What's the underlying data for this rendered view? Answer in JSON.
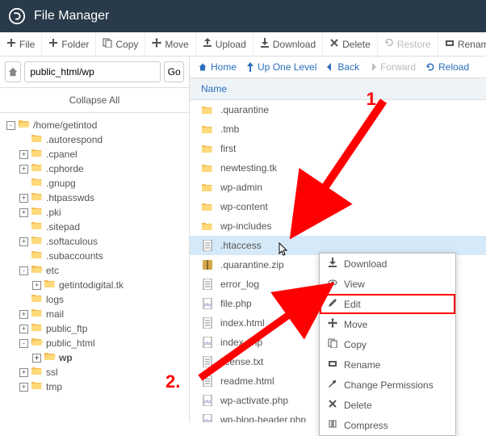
{
  "header": {
    "title": "File Manager"
  },
  "toolbar": [
    {
      "label": "File",
      "icon": "plus"
    },
    {
      "label": "Folder",
      "icon": "plus"
    },
    {
      "label": "Copy",
      "icon": "copy"
    },
    {
      "label": "Move",
      "icon": "move"
    },
    {
      "label": "Upload",
      "icon": "upload"
    },
    {
      "label": "Download",
      "icon": "download"
    },
    {
      "label": "Delete",
      "icon": "delete"
    },
    {
      "label": "Restore",
      "icon": "restore",
      "disabled": true
    },
    {
      "label": "Rename",
      "icon": "rename"
    }
  ],
  "path": {
    "value": "public_html/wp",
    "go": "Go"
  },
  "collapse": "Collapse All",
  "tree": [
    {
      "indent": 0,
      "toggle": "-",
      "type": "folder-open",
      "label": "/home/getintod"
    },
    {
      "indent": 1,
      "toggle": "",
      "type": "folder",
      "label": ".autorespond"
    },
    {
      "indent": 1,
      "toggle": "+",
      "type": "folder",
      "label": ".cpanel"
    },
    {
      "indent": 1,
      "toggle": "+",
      "type": "folder",
      "label": ".cphorde"
    },
    {
      "indent": 1,
      "toggle": "",
      "type": "folder",
      "label": ".gnupg"
    },
    {
      "indent": 1,
      "toggle": "+",
      "type": "folder",
      "label": ".htpasswds"
    },
    {
      "indent": 1,
      "toggle": "+",
      "type": "folder",
      "label": ".pki"
    },
    {
      "indent": 1,
      "toggle": "",
      "type": "folder",
      "label": ".sitepad"
    },
    {
      "indent": 1,
      "toggle": "+",
      "type": "folder",
      "label": ".softaculous"
    },
    {
      "indent": 1,
      "toggle": "",
      "type": "folder",
      "label": ".subaccounts"
    },
    {
      "indent": 1,
      "toggle": "-",
      "type": "folder-open",
      "label": "etc"
    },
    {
      "indent": 2,
      "toggle": "+",
      "type": "folder",
      "label": "getintodigital.tk"
    },
    {
      "indent": 1,
      "toggle": "",
      "type": "folder",
      "label": "logs"
    },
    {
      "indent": 1,
      "toggle": "+",
      "type": "folder",
      "label": "mail"
    },
    {
      "indent": 1,
      "toggle": "+",
      "type": "folder",
      "label": "public_ftp"
    },
    {
      "indent": 1,
      "toggle": "-",
      "type": "folder-open",
      "label": "public_html"
    },
    {
      "indent": 2,
      "toggle": "+",
      "type": "folder-open",
      "label": "wp",
      "bold": true
    },
    {
      "indent": 1,
      "toggle": "+",
      "type": "folder",
      "label": "ssl"
    },
    {
      "indent": 1,
      "toggle": "+",
      "type": "folder",
      "label": "tmp"
    }
  ],
  "nav": {
    "home": "Home",
    "up": "Up One Level",
    "back": "Back",
    "forward": "Forward",
    "reload": "Reload"
  },
  "col": {
    "name": "Name"
  },
  "files": [
    {
      "type": "folder",
      "label": ".quarantine"
    },
    {
      "type": "folder",
      "label": ".tmb"
    },
    {
      "type": "folder",
      "label": "first"
    },
    {
      "type": "folder",
      "label": "newtesting.tk"
    },
    {
      "type": "folder",
      "label": "wp-admin"
    },
    {
      "type": "folder",
      "label": "wp-content"
    },
    {
      "type": "folder",
      "label": "wp-includes"
    },
    {
      "type": "file",
      "label": ".htaccess",
      "selected": true
    },
    {
      "type": "zip",
      "label": ".quarantine.zip"
    },
    {
      "type": "file",
      "label": "error_log"
    },
    {
      "type": "php",
      "label": "file.php"
    },
    {
      "type": "file",
      "label": "index.html"
    },
    {
      "type": "php",
      "label": "index.php"
    },
    {
      "type": "file",
      "label": "license.txt"
    },
    {
      "type": "file",
      "label": "readme.html"
    },
    {
      "type": "php",
      "label": "wp-activate.php"
    },
    {
      "type": "php",
      "label": "wp-blog-header.php"
    }
  ],
  "context": [
    {
      "label": "Download",
      "icon": "download"
    },
    {
      "label": "View",
      "icon": "eye"
    },
    {
      "label": "Edit",
      "icon": "pencil",
      "highlight": true
    },
    {
      "label": "Move",
      "icon": "move"
    },
    {
      "label": "Copy",
      "icon": "copy"
    },
    {
      "label": "Rename",
      "icon": "rename"
    },
    {
      "label": "Change Permissions",
      "icon": "wrench"
    },
    {
      "label": "Delete",
      "icon": "delete"
    },
    {
      "label": "Compress",
      "icon": "compress"
    }
  ],
  "annot": {
    "step1": "1.",
    "step2": "2."
  }
}
